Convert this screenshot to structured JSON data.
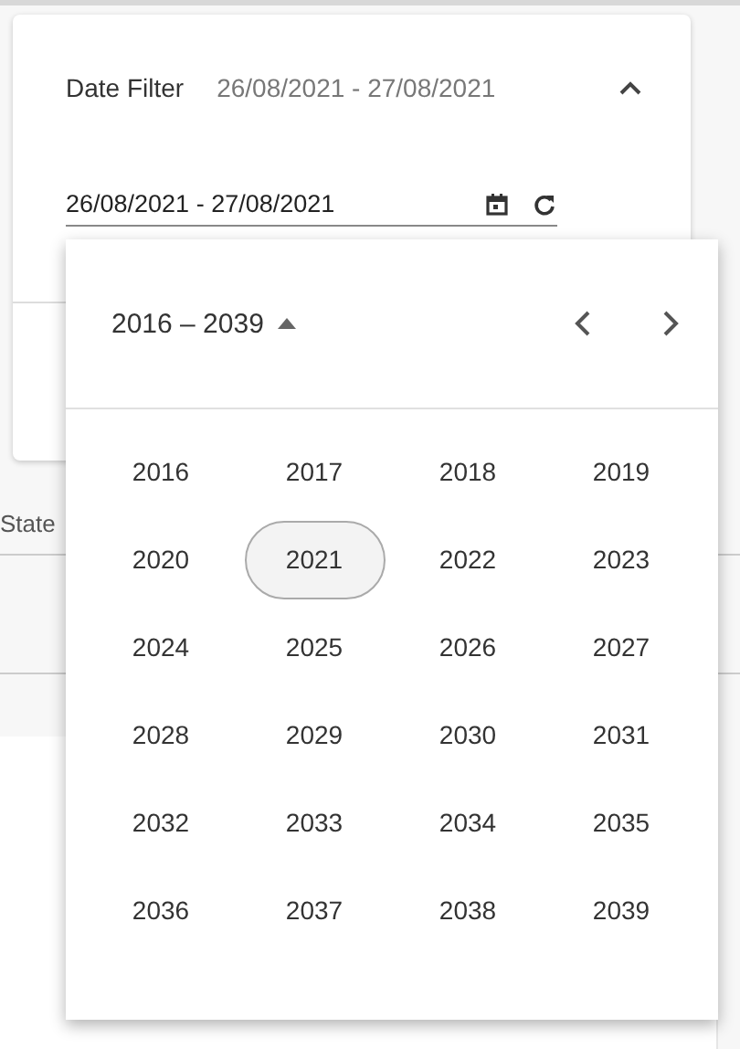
{
  "filter": {
    "label": "Date Filter",
    "summary": "26/08/2021 - 27/08/2021",
    "expanded": true
  },
  "date_range_field": {
    "value": "26/08/2021 - 27/08/2021"
  },
  "background": {
    "column_label": "State"
  },
  "year_picker": {
    "period": "2016 – 2039",
    "years": [
      {
        "label": "2016",
        "selected": false
      },
      {
        "label": "2017",
        "selected": false
      },
      {
        "label": "2018",
        "selected": false
      },
      {
        "label": "2019",
        "selected": false
      },
      {
        "label": "2020",
        "selected": false
      },
      {
        "label": "2021",
        "selected": true
      },
      {
        "label": "2022",
        "selected": false
      },
      {
        "label": "2023",
        "selected": false
      },
      {
        "label": "2024",
        "selected": false
      },
      {
        "label": "2025",
        "selected": false
      },
      {
        "label": "2026",
        "selected": false
      },
      {
        "label": "2027",
        "selected": false
      },
      {
        "label": "2028",
        "selected": false
      },
      {
        "label": "2029",
        "selected": false
      },
      {
        "label": "2030",
        "selected": false
      },
      {
        "label": "2031",
        "selected": false
      },
      {
        "label": "2032",
        "selected": false
      },
      {
        "label": "2033",
        "selected": false
      },
      {
        "label": "2034",
        "selected": false
      },
      {
        "label": "2035",
        "selected": false
      },
      {
        "label": "2036",
        "selected": false
      },
      {
        "label": "2037",
        "selected": false
      },
      {
        "label": "2038",
        "selected": false
      },
      {
        "label": "2039",
        "selected": false
      }
    ]
  }
}
